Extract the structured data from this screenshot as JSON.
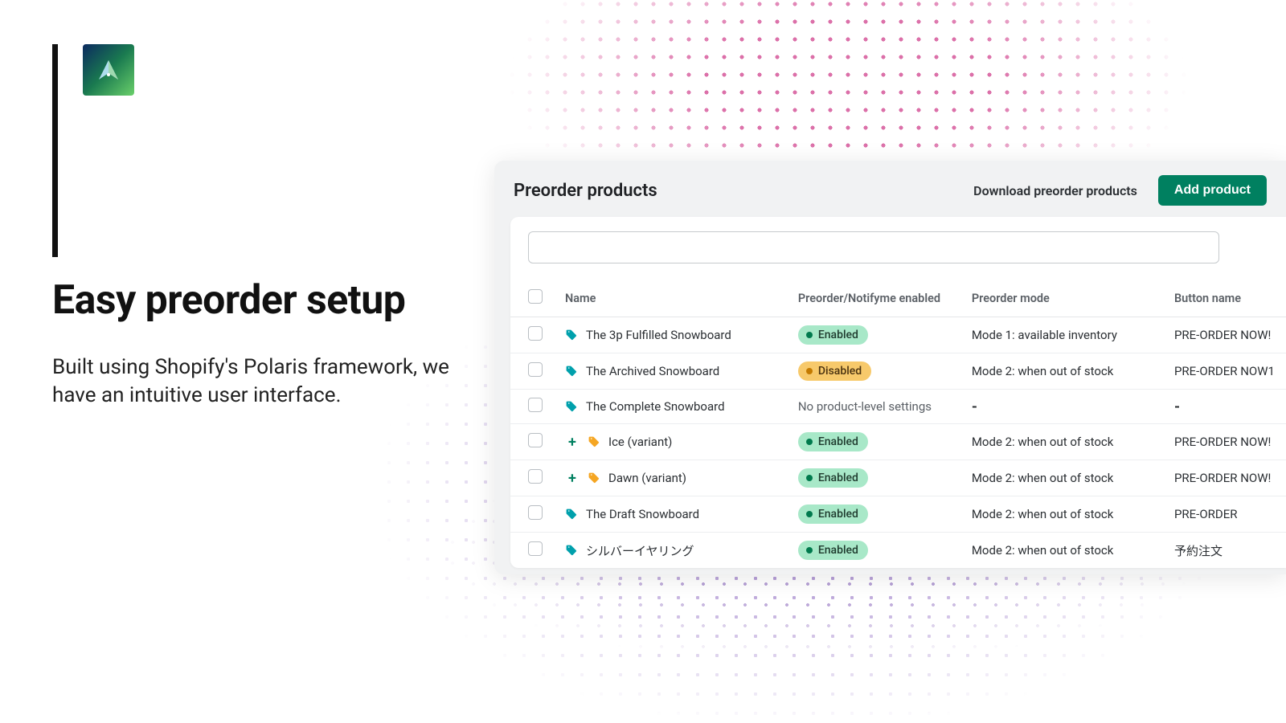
{
  "marketing": {
    "headline": "Easy preorder setup",
    "subtext": "Built using Shopify's Polaris framework, we have an intuitive user interface."
  },
  "panel": {
    "title": "Preorder products",
    "download_label": "Download preorder products",
    "add_button_label": "Add product",
    "search_placeholder": ""
  },
  "columns": {
    "name": "Name",
    "status": "Preorder/Notifyme enabled",
    "mode": "Preorder mode",
    "button_name": "Button name"
  },
  "rows": [
    {
      "name": "The 3p Fulfilled Snowboard",
      "variant": false,
      "icon": "teal",
      "status_kind": "enabled",
      "status_label": "Enabled",
      "mode": "Mode 1: available inventory",
      "button": "PRE-ORDER NOW!"
    },
    {
      "name": "The Archived Snowboard",
      "variant": false,
      "icon": "teal",
      "status_kind": "disabled",
      "status_label": "Disabled",
      "mode": "Mode 2: when out of stock",
      "button": "PRE-ORDER NOW1"
    },
    {
      "name": "The Complete Snowboard",
      "variant": false,
      "icon": "teal",
      "status_kind": "none",
      "status_label": "No product-level settings",
      "mode": "-",
      "button": "-"
    },
    {
      "name": "Ice (variant)",
      "variant": true,
      "icon": "amber",
      "status_kind": "enabled",
      "status_label": "Enabled",
      "mode": "Mode 2: when out of stock",
      "button": "PRE-ORDER NOW!"
    },
    {
      "name": "Dawn (variant)",
      "variant": true,
      "icon": "amber",
      "status_kind": "enabled",
      "status_label": "Enabled",
      "mode": "Mode 2: when out of stock",
      "button": "PRE-ORDER NOW!"
    },
    {
      "name": "The Draft Snowboard",
      "variant": false,
      "icon": "teal",
      "status_kind": "enabled",
      "status_label": "Enabled",
      "mode": "Mode 2: when out of stock",
      "button": "PRE-ORDER"
    },
    {
      "name": "シルバーイヤリング",
      "variant": false,
      "icon": "teal",
      "status_kind": "enabled",
      "status_label": "Enabled",
      "mode": "Mode 2: when out of stock",
      "button": "予約注文"
    }
  ]
}
